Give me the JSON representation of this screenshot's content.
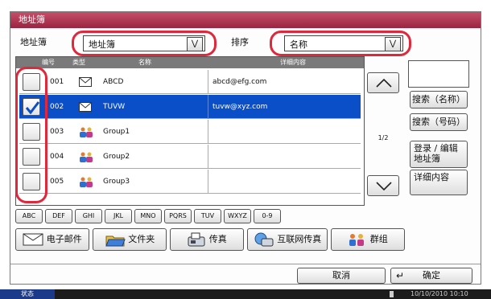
{
  "window": {
    "title": "地址簿"
  },
  "filter": {
    "address_book_label": "地址簿",
    "address_book_value": "地址簿",
    "sort_label": "排序",
    "sort_value": "名称"
  },
  "table": {
    "headers": {
      "number": "编号",
      "type": "类型",
      "name": "名称",
      "detail": "详细内容"
    },
    "rows": [
      {
        "number": "001",
        "name": "ABCD",
        "detail": "abcd@efg.com",
        "checked": false,
        "type_icon": "mail-icon"
      },
      {
        "number": "002",
        "name": "TUVW",
        "detail": "tuvw@xyz.com",
        "checked": true,
        "type_icon": "mail-icon"
      },
      {
        "number": "003",
        "name": "Group1",
        "detail": "",
        "checked": false,
        "type_icon": "group-icon"
      },
      {
        "number": "004",
        "name": "Group2",
        "detail": "",
        "checked": false,
        "type_icon": "group-icon"
      },
      {
        "number": "005",
        "name": "Group3",
        "detail": "",
        "checked": false,
        "type_icon": "group-icon"
      }
    ]
  },
  "pager": {
    "page": "1/2"
  },
  "side_buttons": {
    "search_name": "搜索（名称）",
    "search_number": "搜索（号码）",
    "register_line1": "登录 / 编辑",
    "register_line2": "地址簿",
    "detail": "详细内容"
  },
  "index_keys": [
    "ABC",
    "DEF",
    "GHI",
    "JKL",
    "MNO",
    "PQRS",
    "TUV",
    "WXYZ",
    "0-9"
  ],
  "type_tabs": {
    "email": "电子邮件",
    "folder": "文件夹",
    "fax": "传真",
    "ifax": "互联网传真",
    "group": "群组"
  },
  "footer": {
    "cancel": "取消",
    "ok": "确定"
  },
  "status_bar": {
    "status": "状态",
    "datetime": "10/10/2010  10:10"
  },
  "colors": {
    "title_bar": "#b03a55",
    "selection": "#0a4fc8",
    "highlight_ring": "#e0283c"
  }
}
